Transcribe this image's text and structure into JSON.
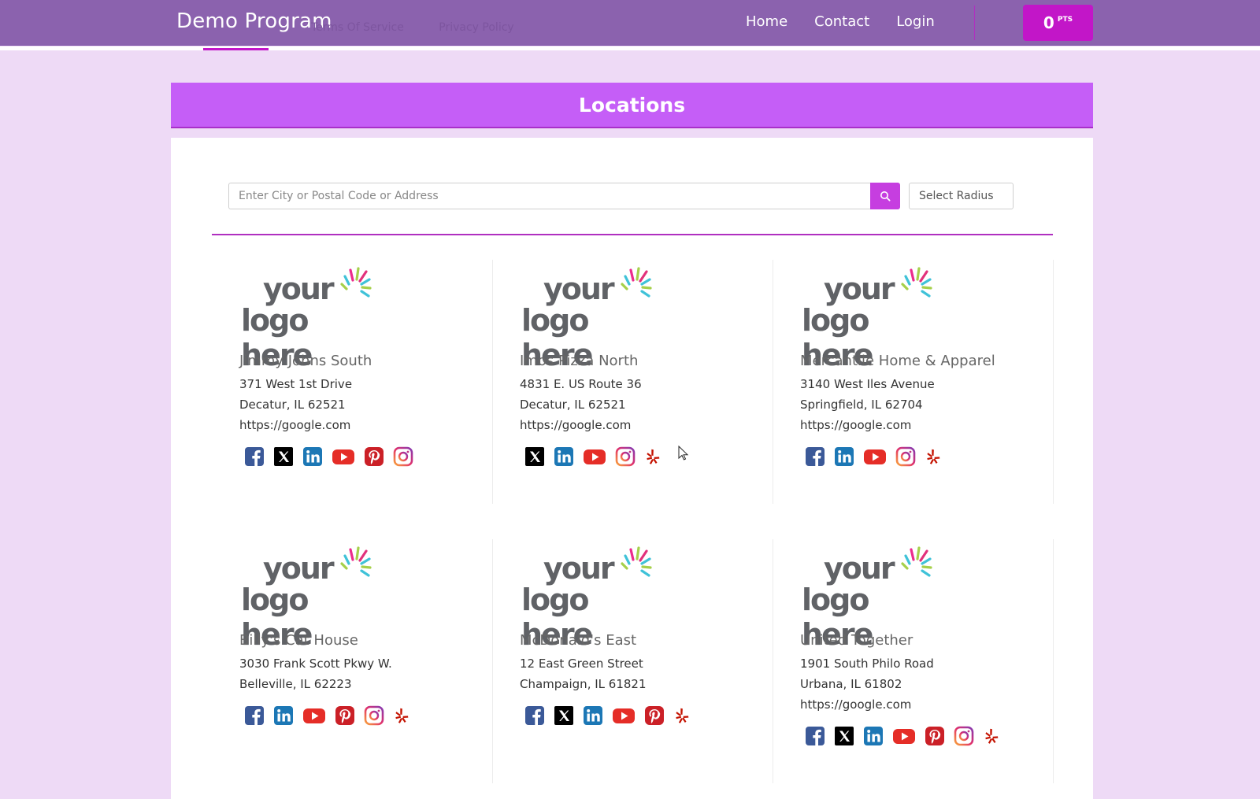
{
  "nav": {
    "brand": "Demo Program",
    "ghost_links": [
      "Terms Of Service",
      "Privacy Policy"
    ],
    "links": [
      "Home",
      "Contact",
      "Login"
    ],
    "points_value": "0",
    "points_label": "PTS"
  },
  "page": {
    "title": "Locations"
  },
  "search": {
    "placeholder": "Enter City or Postal Code or Address",
    "radius_label": "Select Radius"
  },
  "logo_text": {
    "line1": "your",
    "line2": "logo here"
  },
  "locations": [
    {
      "name": "Jimmy Johns South",
      "address1": "371 West 1st Drive",
      "address2": "Decatur, IL 62521",
      "url": "https://google.com",
      "socials": [
        "facebook",
        "x",
        "linkedin",
        "youtube",
        "pinterest",
        "instagram"
      ]
    },
    {
      "name": "Imos Pizza North",
      "address1": "4831 E. US Route 36",
      "address2": "Decatur, IL 62521",
      "url": "https://google.com",
      "socials": [
        "x",
        "linkedin",
        "youtube",
        "instagram",
        "yelp"
      ]
    },
    {
      "name": "Mercantile Home & Apparel",
      "address1": "3140 West Iles Avenue",
      "address2": "Springfield, IL 62704",
      "url": "https://google.com",
      "socials": [
        "facebook",
        "linkedin",
        "youtube",
        "instagram",
        "yelp"
      ]
    },
    {
      "name": "Billy's Cat House",
      "address1": "3030 Frank Scott Pkwy W.",
      "address2": "Belleville, IL 62223",
      "url": "",
      "socials": [
        "facebook",
        "linkedin",
        "youtube",
        "pinterest",
        "instagram",
        "yelp"
      ]
    },
    {
      "name": "McDonald's East",
      "address1": "12 East Green Street",
      "address2": "Champaign, IL 61821",
      "url": "",
      "socials": [
        "facebook",
        "x",
        "linkedin",
        "youtube",
        "pinterest",
        "yelp"
      ]
    },
    {
      "name": "United Together",
      "address1": "1901 South Philo Road",
      "address2": "Urbana, IL 61802",
      "url": "https://google.com",
      "socials": [
        "facebook",
        "x",
        "linkedin",
        "youtube",
        "pinterest",
        "instagram",
        "yelp"
      ]
    }
  ],
  "colors": {
    "nav_bg": "#8b62ae",
    "accent": "#c216c8",
    "header_bg": "#c55ef7",
    "page_bg": "#eedaf6"
  }
}
